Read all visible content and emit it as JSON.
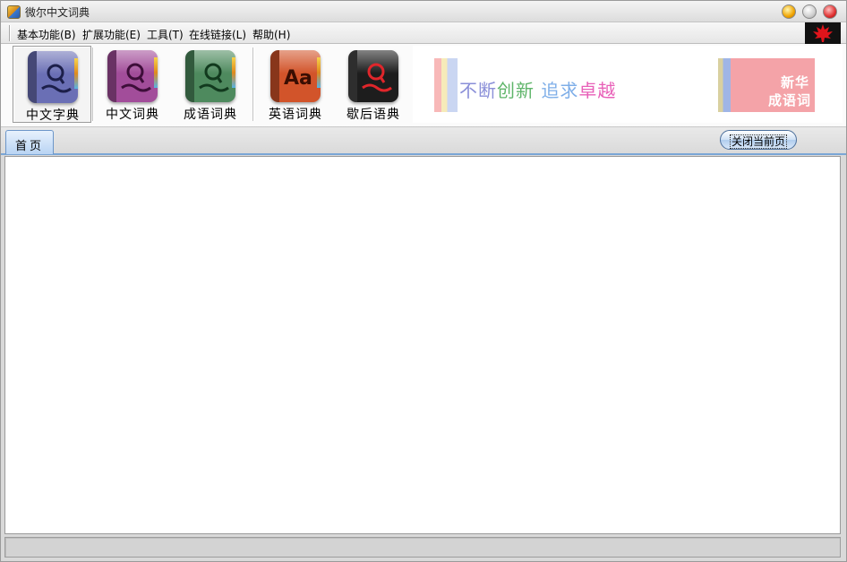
{
  "window": {
    "title": "微尔中文词典"
  },
  "menu": {
    "items": [
      {
        "label": "基本功能(B)"
      },
      {
        "label": "扩展功能(E)"
      },
      {
        "label": "工具(T)"
      },
      {
        "label": "在线链接(L)"
      },
      {
        "label": "帮助(H)"
      }
    ]
  },
  "toolbar": {
    "buttons": [
      {
        "label": "中文字典",
        "icon": "magnifier-book-icon",
        "color": "#6a6fb5"
      },
      {
        "label": "中文词典",
        "icon": "magnifier-book-icon",
        "color": "#a24d9a"
      },
      {
        "label": "成语词典",
        "icon": "magnifier-book-icon",
        "color": "#4e8a5e"
      },
      {
        "label": "英语词典",
        "icon": "aa-book-icon",
        "color": "#d2542a"
      },
      {
        "label": "歇后语典",
        "icon": "magnifier-book-icon",
        "color": "#1d1d1d"
      }
    ]
  },
  "banner": {
    "slogan_parts": [
      "不断",
      "创新",
      "追求",
      "卓越"
    ],
    "slogan_colors": [
      "#8a8fd8",
      "#5fb56a",
      "#7eaee8",
      "#e860b8"
    ],
    "ad_line1": "新华",
    "ad_line2": "成语词"
  },
  "tabs": {
    "home_label": "首页",
    "close_current_label": "关闭当前页"
  }
}
